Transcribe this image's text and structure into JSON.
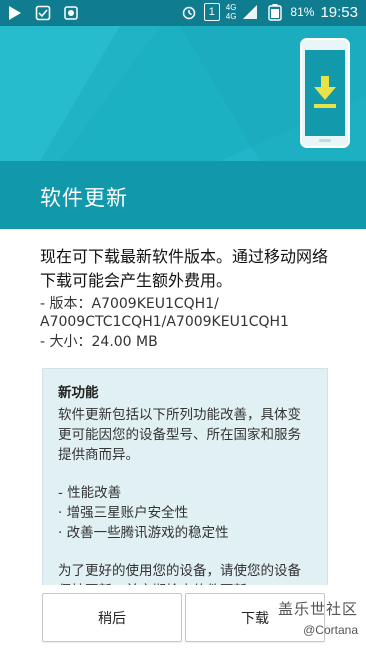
{
  "status_bar": {
    "network_top": "4G",
    "network_bottom": "4G",
    "signal_badge": "1",
    "battery_percent": "81%",
    "time": "19:53",
    "icons": [
      "play-icon",
      "checkbox-icon",
      "gallery-icon",
      "alarm-icon",
      "sim1-icon",
      "signal-icon",
      "battery-icon"
    ]
  },
  "header": {
    "title": "软件更新"
  },
  "content": {
    "intro": "现在可下载最新软件版本。通过移动网络下载可能会产生额外费用。",
    "version_line1": "- 版本：A7009KEU1CQH1/",
    "version_line2": "A7009CTC1CQH1/A7009KEU1CQH1",
    "size": "- 大小：24.00 MB"
  },
  "notes": {
    "title": "新功能",
    "description": "软件更新包括以下所列功能改善，具体变更可能因您的设备型号、所在国家和服务提供商而异。",
    "section_label": "- 性能改善",
    "item1": "· 增强三星账户安全性",
    "item2": "· 改善一些腾讯游戏的稳定性",
    "footer": "为了更好的使用您的设备，请使您的设备保持更新，并定期检查软件更新。"
  },
  "buttons": {
    "later": "稍后",
    "download": "下载"
  },
  "watermark": {
    "line1": "盖乐世社区",
    "line2": "@Cortana"
  },
  "colors": {
    "statusbar": "#0f7d8f",
    "hero": "#20b5c8",
    "header": "#1199ab",
    "notes_bg": "#e1f0f3",
    "download_arrow": "#e8e24a"
  }
}
